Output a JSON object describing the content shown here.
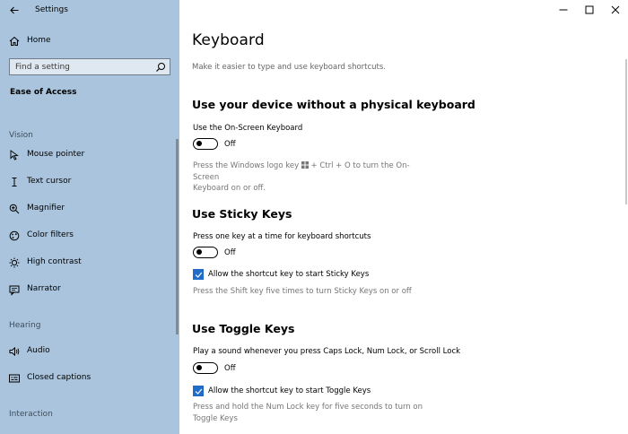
{
  "window": {
    "title": "Settings",
    "controls": [
      "minimize-icon",
      "maximize-icon",
      "close-icon"
    ]
  },
  "sidebar": {
    "home_label": "Home",
    "search_placeholder": "Find a setting",
    "section_title": "Ease of Access",
    "groups": {
      "vision": "Vision",
      "hearing": "Hearing",
      "interaction": "Interaction"
    },
    "items": [
      {
        "label": "Mouse pointer",
        "icon": "mouse-pointer-icon"
      },
      {
        "label": "Text cursor",
        "icon": "text-cursor-icon"
      },
      {
        "label": "Magnifier",
        "icon": "magnifier-icon"
      },
      {
        "label": "Color filters",
        "icon": "color-filters-icon"
      },
      {
        "label": "High contrast",
        "icon": "high-contrast-icon"
      },
      {
        "label": "Narrator",
        "icon": "narrator-icon"
      },
      {
        "label": "Audio",
        "icon": "audio-icon"
      },
      {
        "label": "Closed captions",
        "icon": "closed-captions-icon"
      }
    ]
  },
  "main": {
    "title": "Keyboard",
    "subtitle": "Make it easier to type and use keyboard shortcuts.",
    "sections": {
      "osk": {
        "heading": "Use your device without a physical keyboard",
        "label": "Use the On-Screen Keyboard",
        "state": "Off",
        "help_before": "Press the Windows logo key",
        "help_after": "+ Ctrl + O to turn the On-Screen",
        "help_line2": "Keyboard on or off."
      },
      "sticky": {
        "heading": "Use Sticky Keys",
        "label": "Press one key at a time for keyboard shortcuts",
        "state": "Off",
        "checkbox_label": "Allow the shortcut key to start Sticky Keys",
        "help": "Press the Shift key five times to turn Sticky Keys on or off"
      },
      "toggle": {
        "heading": "Use Toggle Keys",
        "label": "Play a sound whenever you press Caps Lock, Num Lock, or Scroll Lock",
        "state": "Off",
        "checkbox_label": "Allow the shortcut key to start Toggle Keys",
        "help": "Press and hold the Num Lock key for five seconds to turn on Toggle Keys"
      }
    }
  },
  "colors": {
    "sidebar_bg": "#a9c4dc",
    "accent": "#1f6cc9",
    "help_text": "#767676"
  }
}
